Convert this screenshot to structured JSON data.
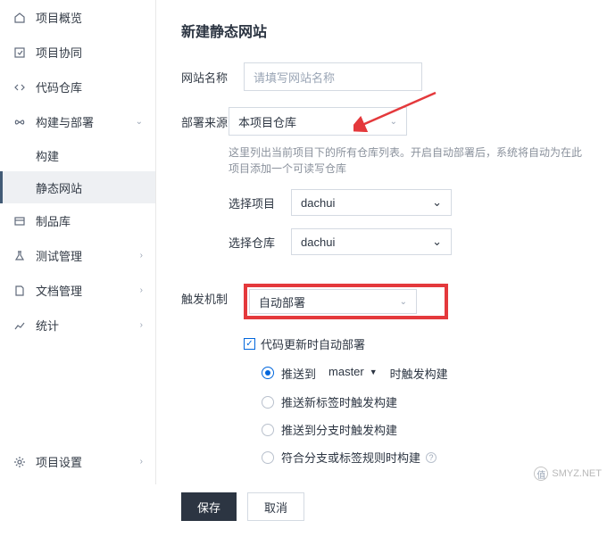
{
  "sidebar": {
    "items": [
      {
        "label": "项目概览"
      },
      {
        "label": "项目协同"
      },
      {
        "label": "代码仓库"
      },
      {
        "label": "构建与部署"
      },
      {
        "label": "制品库"
      },
      {
        "label": "测试管理"
      },
      {
        "label": "文档管理"
      },
      {
        "label": "统计"
      }
    ],
    "sub_build": "构建",
    "sub_static": "静态网站",
    "settings": "项目设置"
  },
  "main": {
    "title": "新建静态网站",
    "site_name_label": "网站名称",
    "site_name_placeholder": "请填写网站名称",
    "deploy_source_label": "部署来源",
    "deploy_source_value": "本项目仓库",
    "deploy_hint": "这里列出当前项目下的所有仓库列表。开启自动部署后，系统将自动为在此项目添加一个可读写仓库",
    "select_project_label": "选择项目",
    "select_project_value": "dachui",
    "select_repo_label": "选择仓库",
    "select_repo_value": "dachui",
    "trigger_label": "触发机制",
    "trigger_value": "自动部署",
    "auto_deploy_checkbox": "代码更新时自动部署",
    "opt_push_to": "推送到",
    "opt_push_branch": "master",
    "opt_push_suffix": "时触发构建",
    "opt_tag": "推送新标签时触发构建",
    "opt_branch": "推送到分支时触发构建",
    "opt_rule": "符合分支或标签规则时构建",
    "save": "保存",
    "cancel": "取消"
  },
  "watermark": {
    "badge": "值",
    "text": "SMYZ.NET"
  }
}
